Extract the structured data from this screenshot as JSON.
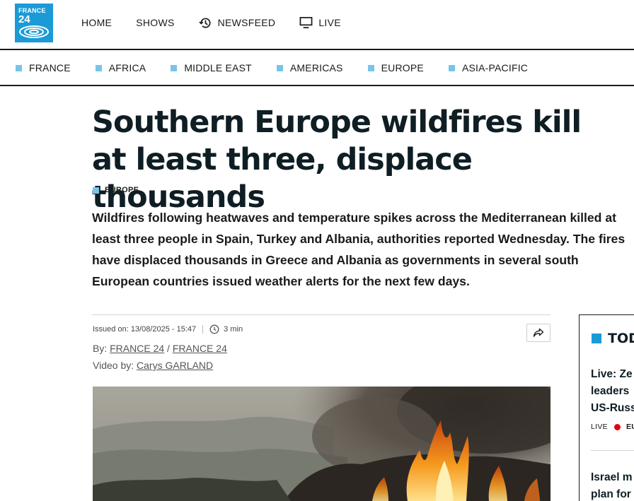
{
  "logo": {
    "line1": "FRANCE",
    "line2": "24"
  },
  "main_nav": [
    {
      "label": "HOME",
      "icon": ""
    },
    {
      "label": "SHOWS",
      "icon": ""
    },
    {
      "label": "NEWSFEED",
      "icon": "history-icon"
    },
    {
      "label": "LIVE",
      "icon": "monitor-icon"
    }
  ],
  "region_nav": [
    "FRANCE",
    "AFRICA",
    "MIDDLE EAST",
    "AMERICAS",
    "EUROPE",
    "ASIA-PACIFIC"
  ],
  "article": {
    "title": "Southern Europe wildfires kill at least three, displace thousands",
    "tag": "EUROPE",
    "lead": "Wildfires following heatwaves and temperature spikes across the Mediterranean killed at least three people in Spain, Turkey and Albania, authorities reported Wednesday. The fires have displaced thousands in Greece and Albania as governments in several south European countries issued weather alerts for the next few days.",
    "issued": "Issued on: 13/08/2025 - 15:47",
    "read_time": "3 min",
    "by_label": "By:",
    "authors": [
      "FRANCE 24",
      "FRANCE 24"
    ],
    "author_sep": "/",
    "video_label": "Video by:",
    "video_author": "Carys GARLAND"
  },
  "sidebar": {
    "heading": "TOD",
    "item1_lines": [
      "Live: Ze",
      "leaders",
      "US-Russ"
    ],
    "live_label": "LIVE",
    "live_tag": "EU",
    "item2_lines": [
      "Israel m",
      "plan for"
    ]
  },
  "colors": {
    "brand": "#1a9bd7",
    "accent_square": "#77c4ea",
    "live_dot": "#e3000f"
  }
}
